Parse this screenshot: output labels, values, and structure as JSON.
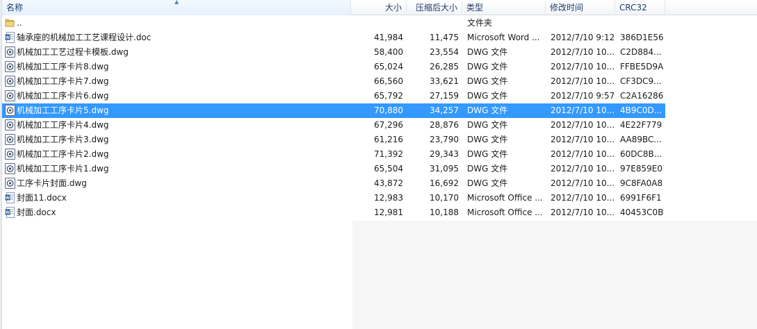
{
  "columns": {
    "name": "名称",
    "size": "大小",
    "packed": "压缩后大小",
    "type": "类型",
    "modified": "修改时间",
    "crc": "CRC32"
  },
  "files": [
    {
      "icon": "folder-icon",
      "name": "..",
      "size": "",
      "packed": "",
      "type": "文件夹",
      "modified": "",
      "crc": "",
      "selected": false
    },
    {
      "icon": "word-doc-icon",
      "name": "轴承座的机械加工工艺课程设计.doc",
      "size": "41,984",
      "packed": "11,475",
      "type": "Microsoft Word ...",
      "modified": "2012/7/10 9:12",
      "crc": "386D1E56",
      "selected": false
    },
    {
      "icon": "dwg-file-icon",
      "name": "机械加工工艺过程卡模板.dwg",
      "size": "58,400",
      "packed": "23,554",
      "type": "DWG 文件",
      "modified": "2012/7/10 10...",
      "crc": "C2D884...",
      "selected": false
    },
    {
      "icon": "dwg-file-icon",
      "name": "机械加工工序卡片8.dwg",
      "size": "65,024",
      "packed": "26,285",
      "type": "DWG 文件",
      "modified": "2012/7/10 10...",
      "crc": "FFBE5D9A",
      "selected": false
    },
    {
      "icon": "dwg-file-icon",
      "name": "机械加工工序卡片7.dwg",
      "size": "66,560",
      "packed": "33,621",
      "type": "DWG 文件",
      "modified": "2012/7/10 10...",
      "crc": "CF3DC9...",
      "selected": false
    },
    {
      "icon": "dwg-file-icon",
      "name": "机械加工工序卡片6.dwg",
      "size": "65,792",
      "packed": "27,159",
      "type": "DWG 文件",
      "modified": "2012/7/10 9:57",
      "crc": "C2A16286",
      "selected": false
    },
    {
      "icon": "dwg-file-icon",
      "name": "机械加工工序卡片5.dwg",
      "size": "70,880",
      "packed": "34,257",
      "type": "DWG 文件",
      "modified": "2012/7/10 10...",
      "crc": "4B9C0D...",
      "selected": true
    },
    {
      "icon": "dwg-file-icon",
      "name": "机械加工工序卡片4.dwg",
      "size": "67,296",
      "packed": "28,876",
      "type": "DWG 文件",
      "modified": "2012/7/10 10...",
      "crc": "4E22F779",
      "selected": false
    },
    {
      "icon": "dwg-file-icon",
      "name": "机械加工工序卡片3.dwg",
      "size": "61,216",
      "packed": "23,790",
      "type": "DWG 文件",
      "modified": "2012/7/10 10...",
      "crc": "AA89BC...",
      "selected": false
    },
    {
      "icon": "dwg-file-icon",
      "name": "机械加工工序卡片2.dwg",
      "size": "71,392",
      "packed": "29,343",
      "type": "DWG 文件",
      "modified": "2012/7/10 10...",
      "crc": "60DC8B...",
      "selected": false
    },
    {
      "icon": "dwg-file-icon",
      "name": "机械加工工序卡片1.dwg",
      "size": "65,504",
      "packed": "31,095",
      "type": "DWG 文件",
      "modified": "2012/7/10 10...",
      "crc": "97E859E0",
      "selected": false
    },
    {
      "icon": "dwg-file-icon",
      "name": "工序卡片封面.dwg",
      "size": "43,872",
      "packed": "16,692",
      "type": "DWG 文件",
      "modified": "2012/7/10 10...",
      "crc": "9C8FA0A8",
      "selected": false
    },
    {
      "icon": "word-doc-icon",
      "name": "封面11.docx",
      "size": "12,983",
      "packed": "10,170",
      "type": "Microsoft Office ...",
      "modified": "2012/7/10 10...",
      "crc": "6991F6F1",
      "selected": false
    },
    {
      "icon": "word-doc-icon",
      "name": "封面.docx",
      "size": "12,981",
      "packed": "10,188",
      "type": "Microsoft Office ...",
      "modified": "2012/7/10 10...",
      "crc": "40453C0B",
      "selected": false
    }
  ],
  "colors": {
    "selection": "#3399ff",
    "header_text": "#1e3d6b",
    "folder": "#e9c15a",
    "word": "#2b5797"
  }
}
